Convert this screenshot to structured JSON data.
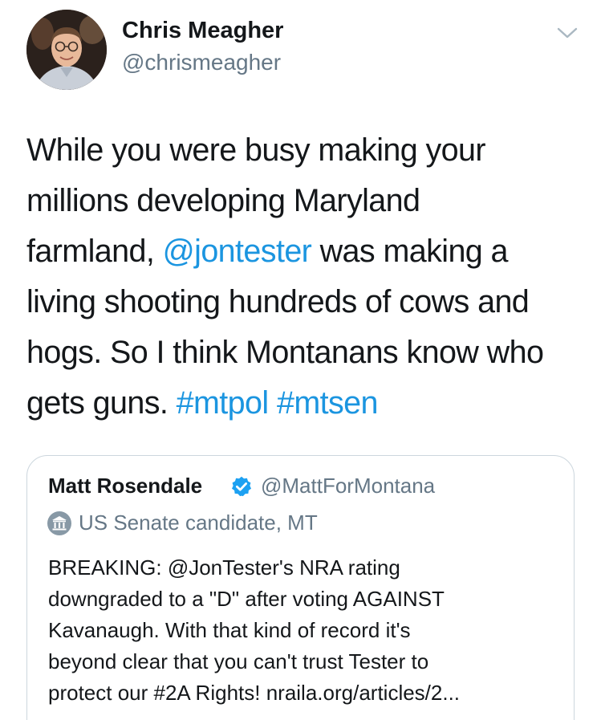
{
  "author": {
    "display_name": "Chris Meagher",
    "handle": "@chrismeagher",
    "avatar_icon": "profile-photo"
  },
  "menu_icon": "chevron-down-icon",
  "tweet": {
    "lines": [
      [
        {
          "text": "While you were busy making your"
        }
      ],
      [
        {
          "text": "millions developing Maryland"
        }
      ],
      [
        {
          "text": "farmland, "
        },
        {
          "text": "@jontester",
          "link": true
        },
        {
          "text": " was making a"
        }
      ],
      [
        {
          "text": "living shooting hundreds of cows and"
        }
      ],
      [
        {
          "text": "hogs. So I think Montanans know who"
        }
      ],
      [
        {
          "text": "gets guns. "
        },
        {
          "text": "#mtpol",
          "link": true
        },
        {
          "text": " "
        },
        {
          "text": "#mtsen",
          "link": true
        }
      ]
    ]
  },
  "quoted_tweet": {
    "display_name": "Matt Rosendale",
    "verified_icon": "verified-badge-icon",
    "handle": "@MattForMontana",
    "label_icon": "government-building-icon",
    "label": "US Senate candidate, MT",
    "lines": [
      "BREAKING: @JonTester's NRA rating",
      "downgraded to a \"D\" after voting AGAINST",
      "Kavanaugh. With that kind of record it's",
      "beyond clear that you can't trust Tester to",
      "protect our #2A Rights! nraila.org/articles/2..."
    ]
  },
  "colors": {
    "text": "#14171a",
    "secondary": "#657786",
    "link": "#1b95e0",
    "border": "#ccd6dd"
  }
}
